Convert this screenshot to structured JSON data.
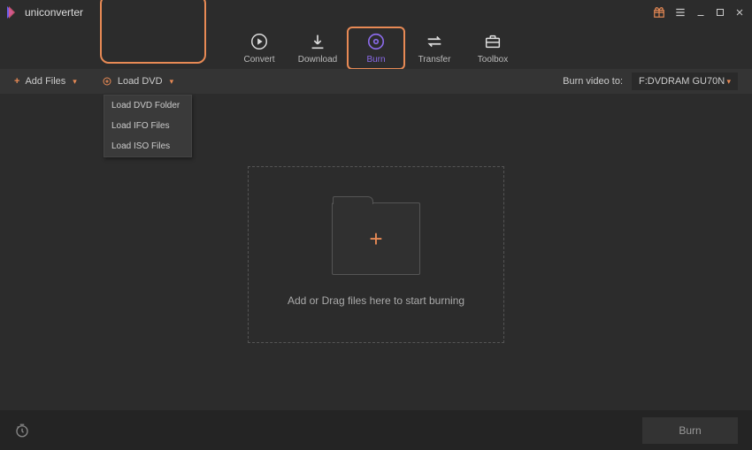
{
  "app": {
    "title": "uniconverter"
  },
  "window_controls": {
    "gift": "gift-icon",
    "menu": "menu-icon",
    "minimize": "minimize-icon",
    "maximize": "maximize-icon",
    "close": "close-icon"
  },
  "tabs": [
    {
      "key": "convert",
      "label": "Convert",
      "icon": "play-circle-icon"
    },
    {
      "key": "download",
      "label": "Download",
      "icon": "download-icon"
    },
    {
      "key": "burn",
      "label": "Burn",
      "icon": "disc-icon",
      "active": true
    },
    {
      "key": "transfer",
      "label": "Transfer",
      "icon": "transfer-icon"
    },
    {
      "key": "toolbox",
      "label": "Toolbox",
      "icon": "toolbox-icon"
    }
  ],
  "toolbar": {
    "add_files_label": "Add Files",
    "load_dvd_label": "Load DVD",
    "load_dvd_menu": [
      "Load DVD Folder",
      "Load IFO Files",
      "Load ISO Files"
    ],
    "burn_to_label": "Burn video to:",
    "burn_to_value": "F:DVDRAM GU70N"
  },
  "dropzone": {
    "text": "Add or Drag files here to start burning"
  },
  "bottom": {
    "burn_button": "Burn"
  },
  "colors": {
    "accent_orange": "#e88a55",
    "accent_purple": "#8a6ae8",
    "bg": "#2c2c2c"
  }
}
